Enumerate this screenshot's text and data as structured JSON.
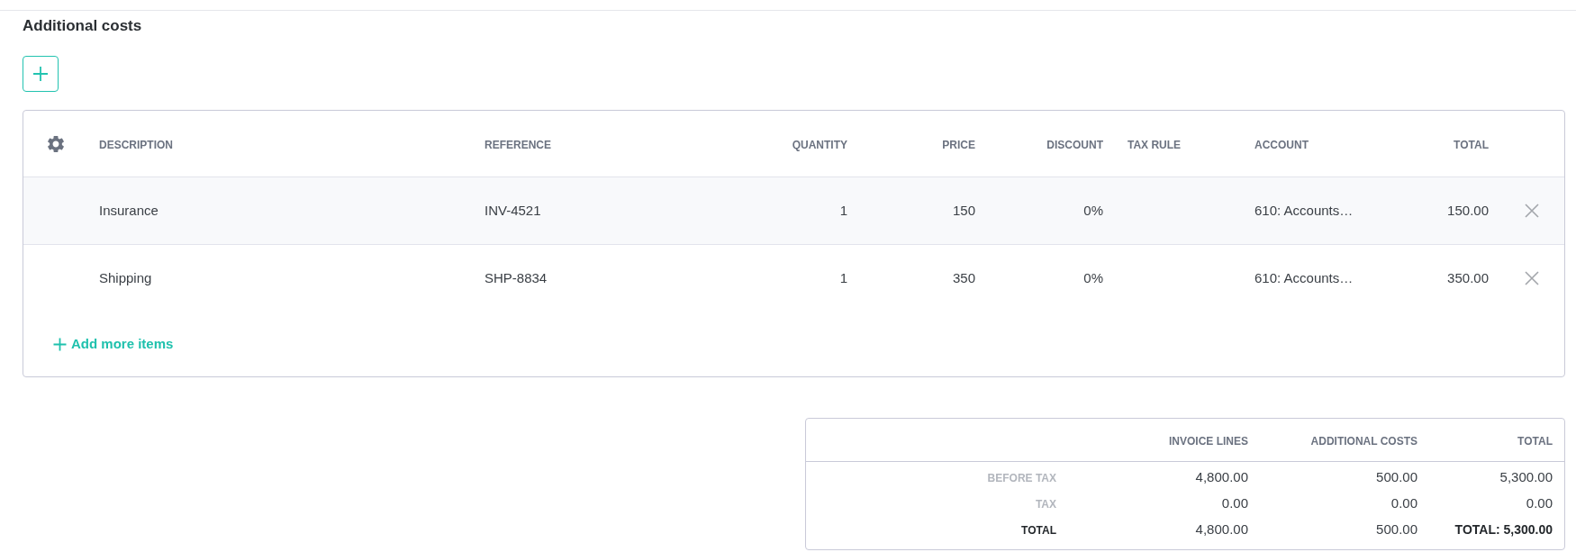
{
  "section": {
    "title": "Additional costs"
  },
  "table": {
    "columns": [
      "DESCRIPTION",
      "REFERENCE",
      "QUANTITY",
      "PRICE",
      "DISCOUNT",
      "TAX RULE",
      "ACCOUNT",
      "TOTAL"
    ],
    "rows": [
      {
        "description": "Insurance",
        "reference": "INV-4521",
        "quantity": "1",
        "price": "150",
        "discount": "0%",
        "account": "610: Accounts…",
        "total": "150.00",
        "highlighted": true
      },
      {
        "description": "Shipping",
        "reference": "SHP-8834",
        "quantity": "1",
        "price": "350",
        "discount": "0%",
        "account": "610: Accounts…",
        "total": "350.00",
        "highlighted": false
      }
    ],
    "add_link": {
      "label": "Add more items"
    }
  },
  "summary": {
    "columns": [
      "INVOICE LINES",
      "ADDITIONAL COSTS",
      "TOTAL"
    ],
    "rows": [
      {
        "kind": "subtotal",
        "label": "BEFORE TAX",
        "values": [
          "4,800.00",
          "500.00",
          "5,300.00"
        ]
      },
      {
        "kind": "subtotal",
        "label": "TAX",
        "values": [
          "0.00",
          "0.00",
          "0.00"
        ]
      },
      {
        "kind": "total",
        "label": "TOTAL",
        "values": [
          "4,800.00",
          "500.00",
          "TOTAL: 5,300.00"
        ]
      }
    ]
  }
}
